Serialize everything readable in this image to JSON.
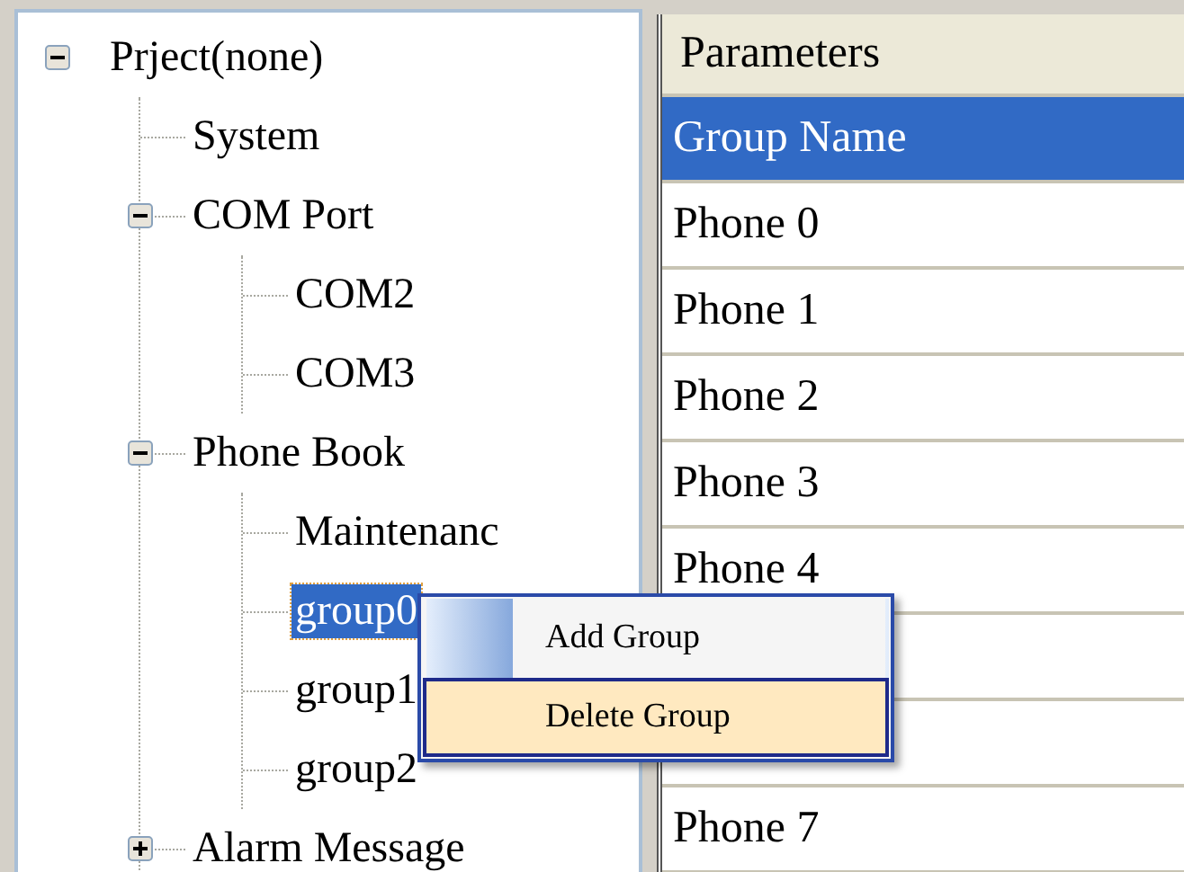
{
  "tree": {
    "label": "Prject(none)",
    "expanded": true,
    "selected": false,
    "children": [
      {
        "label": "System",
        "selected": false
      },
      {
        "label": "COM Port",
        "expanded": true,
        "selected": false,
        "children": [
          {
            "label": "COM2",
            "selected": false
          },
          {
            "label": "COM3",
            "selected": false
          }
        ]
      },
      {
        "label": "Phone Book",
        "expanded": true,
        "selected": false,
        "children": [
          {
            "label": "Maintenanc",
            "selected": false
          },
          {
            "label": "group0",
            "selected": true
          },
          {
            "label": "group1",
            "selected": false
          },
          {
            "label": "group2",
            "selected": false
          }
        ]
      },
      {
        "label": "Alarm Message",
        "expanded": false,
        "selected": false
      }
    ]
  },
  "grid": {
    "header": "Parameters",
    "rows": [
      {
        "label": "Group Name",
        "selected": true
      },
      {
        "label": "Phone 0",
        "selected": false
      },
      {
        "label": "Phone 1",
        "selected": false
      },
      {
        "label": "Phone 2",
        "selected": false
      },
      {
        "label": "Phone 3",
        "selected": false
      },
      {
        "label": "Phone 4",
        "selected": false
      },
      {
        "selected": false
      },
      {
        "selected": false
      },
      {
        "label": "Phone 7",
        "selected": false
      }
    ]
  },
  "context_menu": {
    "items": [
      {
        "label": "Add Group",
        "selected": false
      },
      {
        "label": "Delete Group",
        "selected": true
      }
    ]
  }
}
